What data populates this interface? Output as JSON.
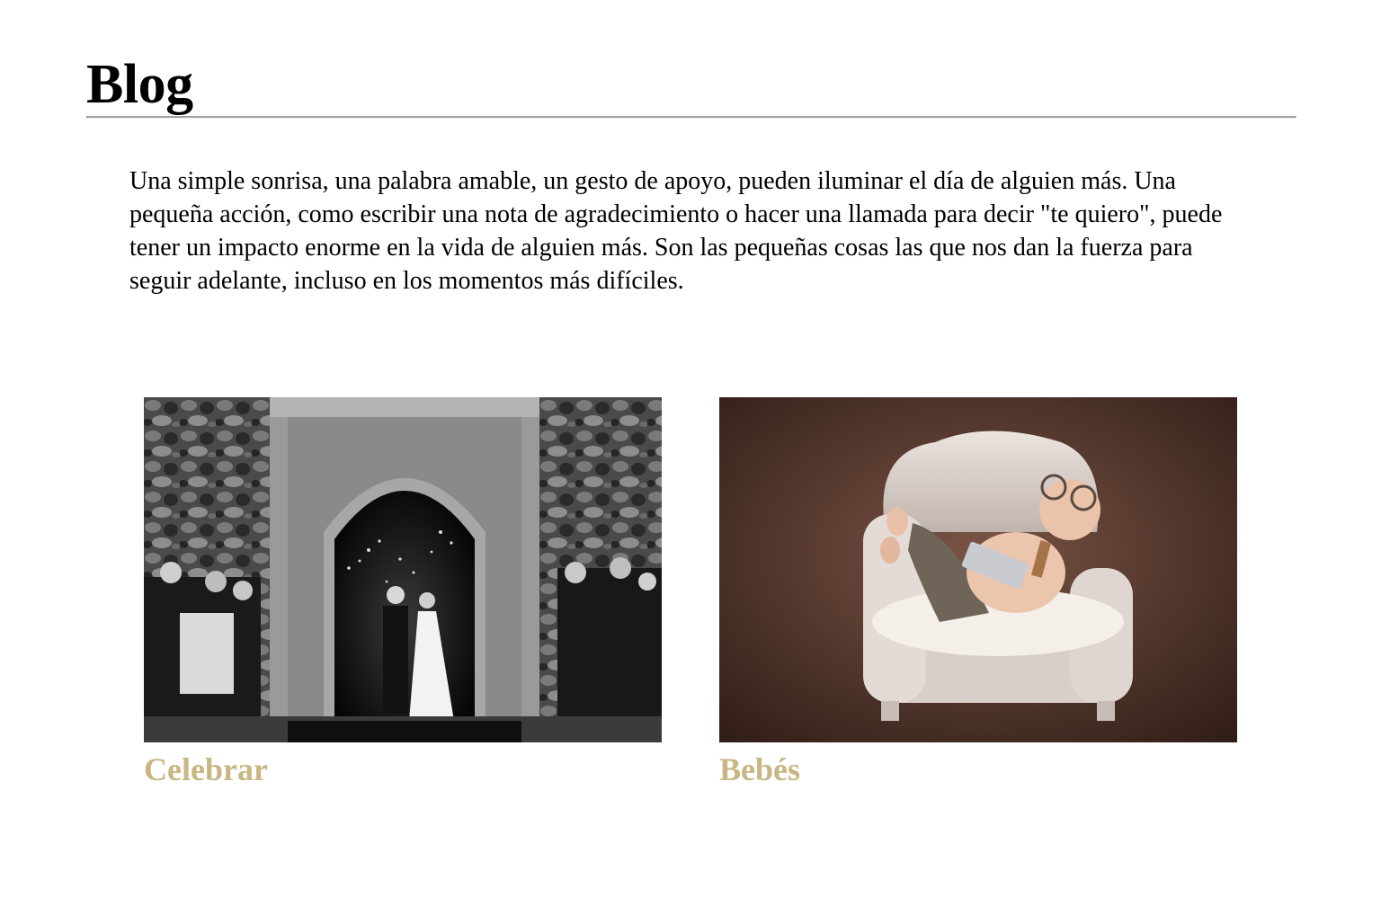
{
  "page": {
    "title": "Blog",
    "intro": "Una simple sonrisa, una palabra amable, un gesto de apoyo, pueden iluminar el día de alguien más. Una pequeña acción, como escribir una nota de agradecimiento o hacer una llamada para decir \"te quiero\", puede tener un impacto enorme en la vida de alguien más. Son las pequeñas cosas las que nos dan la fuerza para seguir adelante, incluso en los momentos más difíciles."
  },
  "colors": {
    "link": "#c8b784",
    "rule": "#a0a0a0"
  },
  "posts": [
    {
      "title": "Celebrar",
      "image": "wedding-photo"
    },
    {
      "title": "Bebés",
      "image": "newborn-photo"
    }
  ]
}
